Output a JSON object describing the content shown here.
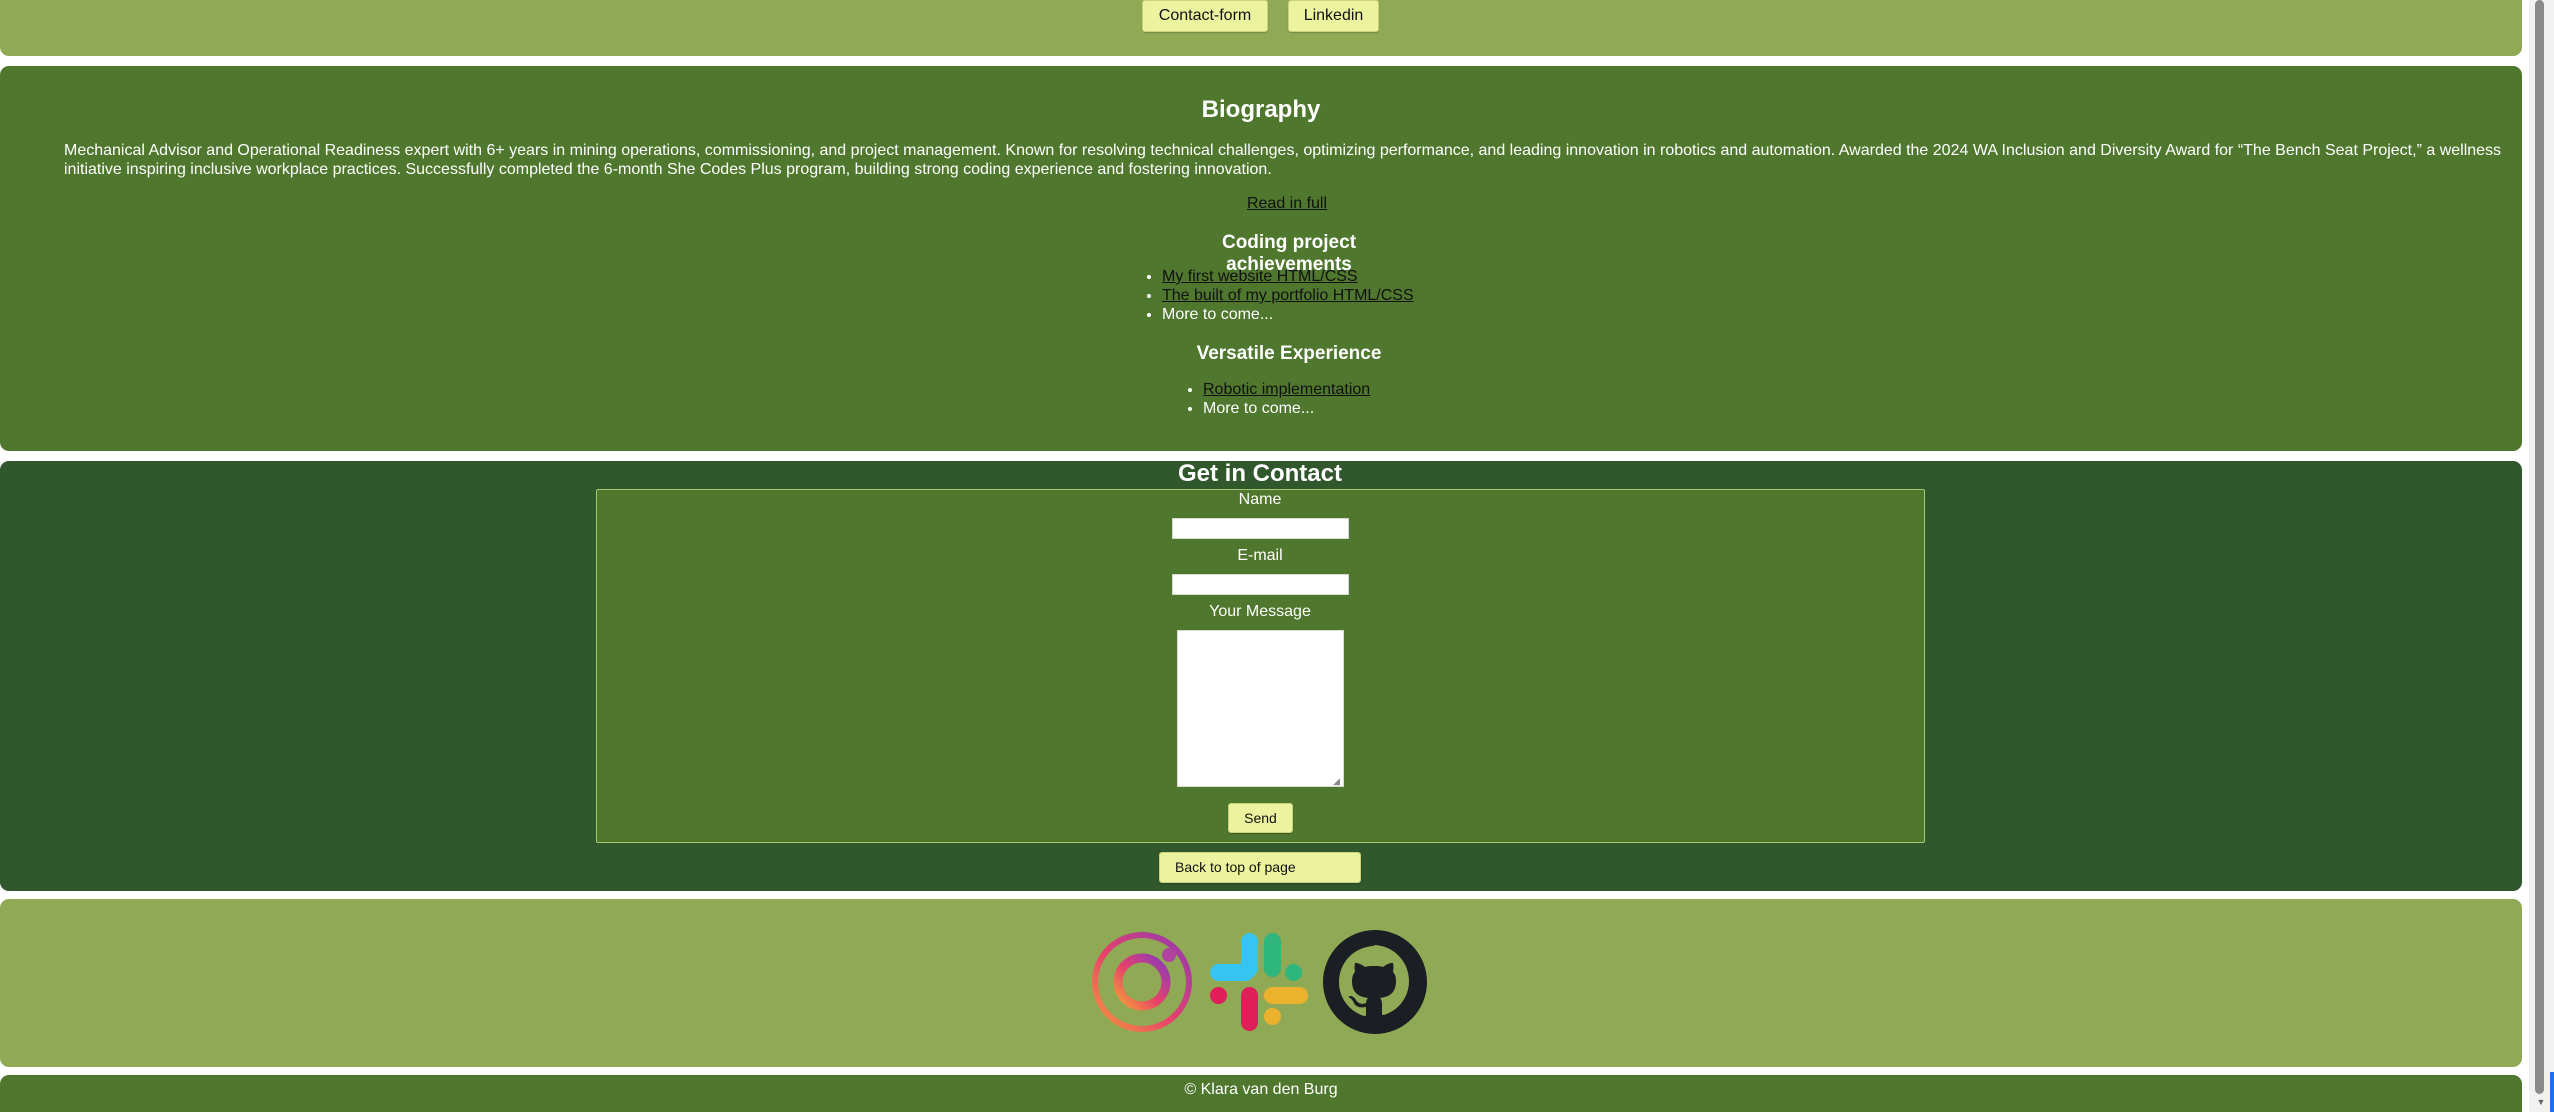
{
  "nav": {
    "contact_label": "Contact-form",
    "linkedin_label": "Linkedin"
  },
  "biography": {
    "title": "Biography",
    "text": "Mechanical Advisor and Operational Readiness expert with 6+ years in mining operations, commissioning, and project management. Known for resolving technical challenges, optimizing performance, and leading innovation in robotics and automation. Awarded the 2024 WA Inclusion and Diversity Award for “The Bench Seat Project,” a wellness initiative inspiring inclusive workplace practices. Successfully completed the 6-month She Codes Plus program, building strong coding experience and fostering innovation.",
    "read_more": "Read in full",
    "coding_title": "Coding project achievements",
    "coding_items": [
      "My first website HTML/CSS",
      "The built of my portfolio HTML/CSS",
      "More to come..."
    ],
    "versatile_title": "Versatile Experience",
    "versatile_items": [
      "Robotic implementation",
      "More to come..."
    ]
  },
  "contact": {
    "title": "Get in Contact",
    "name_label": "Name",
    "email_label": "E-mail",
    "message_label": "Your Message",
    "name_value": "",
    "email_value": "",
    "message_value": "",
    "send_label": "Send",
    "back_to_top_label": "Back to top of page"
  },
  "social": {
    "icons": [
      "instagram-icon",
      "slack-icon",
      "github-icon"
    ]
  },
  "footer": {
    "copyright": "© Klara van den Burg"
  },
  "colors": {
    "light_green": "#90a955",
    "mid_green": "#4f772d",
    "dark_green": "#31572c",
    "button_yellow": "#ecf39e"
  }
}
